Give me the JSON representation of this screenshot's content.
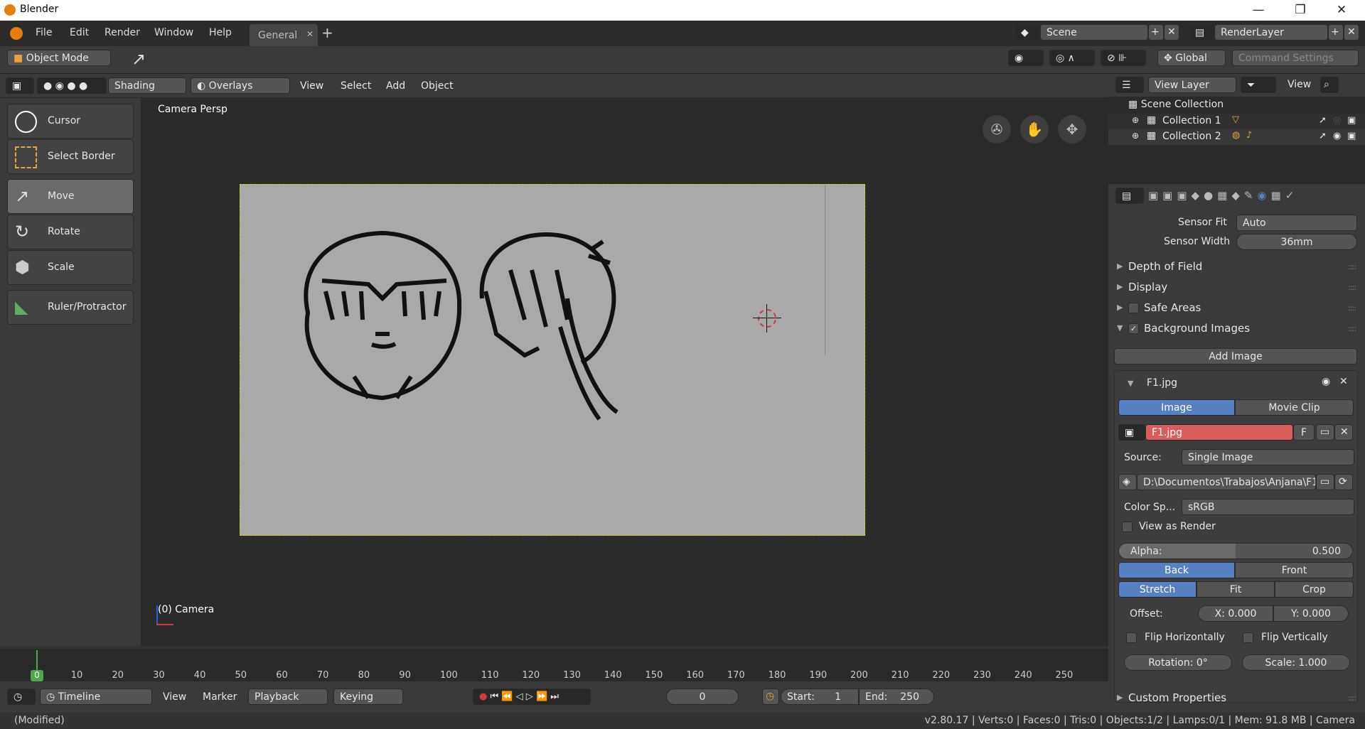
{
  "window": {
    "title": "Blender",
    "min": "—",
    "max": "❐",
    "close": "✕"
  },
  "menu": {
    "file": "File",
    "edit": "Edit",
    "render": "Render",
    "window": "Window",
    "help": "Help"
  },
  "workspace_tab": {
    "label": "General",
    "close": "✕",
    "add": "+"
  },
  "scene": {
    "name": "Scene",
    "render_layer": "RenderLayer"
  },
  "header": {
    "mode": "Object Mode",
    "orientation": "Global",
    "command_settings": "Command Settings",
    "shading": "Shading",
    "overlays": "Overlays",
    "view": "View",
    "select": "Select",
    "add": "Add",
    "object": "Object"
  },
  "tools": [
    {
      "label": "Cursor"
    },
    {
      "label": "Select Border"
    },
    {
      "label": "Move"
    },
    {
      "label": "Rotate"
    },
    {
      "label": "Scale"
    },
    {
      "label": "Ruler/Protractor"
    }
  ],
  "viewport": {
    "camera_label": "Camera Persp",
    "object_label": "(0) Camera"
  },
  "timeline": {
    "ticks": [
      "0",
      "10",
      "20",
      "30",
      "40",
      "50",
      "60",
      "70",
      "80",
      "90",
      "100",
      "110",
      "120",
      "130",
      "140",
      "150",
      "160",
      "170",
      "180",
      "190",
      "200",
      "210",
      "220",
      "230",
      "240",
      "250"
    ],
    "current_frame_marker": "0",
    "editor": "Timeline",
    "view": "View",
    "marker": "Marker",
    "playback": "Playback",
    "keying": "Keying",
    "frame": "0",
    "start_label": "Start:",
    "start": "1",
    "end_label": "End:",
    "end": "250"
  },
  "status": {
    "left": "(Modified)",
    "right": "v2.80.17 | Verts:0 | Faces:0 | Tris:0 | Objects:1/2 | Lamps:0/1 | Mem: 91.8 MB | Camera"
  },
  "outliner": {
    "view_layer": "View Layer",
    "view": "View",
    "scene_collection": "Scene Collection",
    "collections": [
      "Collection 1",
      "Collection 2"
    ]
  },
  "properties": {
    "sensor_fit_label": "Sensor Fit",
    "sensor_fit": "Auto",
    "sensor_width_label": "Sensor Width",
    "sensor_width": "36mm",
    "panels": {
      "dof": "Depth of Field",
      "display": "Display",
      "safe_areas": "Safe Areas",
      "bg_images": "Background Images",
      "custom": "Custom Properties"
    },
    "add_image": "Add Image",
    "image_name": "F1.jpg",
    "image_tab": "Image",
    "movie_tab": "Movie Clip",
    "image_field": "F1.jpg",
    "fake_user": "F",
    "source_label": "Source:",
    "source": "Single Image",
    "path": "D:\\Documentos\\Trabajos\\Anjana\\F1....",
    "colorspace_label": "Color Sp...",
    "colorspace": "sRGB",
    "view_as_render": "View as Render",
    "alpha_label": "Alpha:",
    "alpha": "0.500",
    "alpha_fraction": 0.5,
    "back": "Back",
    "front": "Front",
    "stretch": "Stretch",
    "fit": "Fit",
    "crop": "Crop",
    "offset_label": "Offset:",
    "offset_x": "X:  0.000",
    "offset_y": "Y:  0.000",
    "flip_h": "Flip Horizontally",
    "flip_v": "Flip Vertically",
    "rotation": "Rotation:     0°",
    "scale": "Scale:       1.000"
  },
  "colors": {
    "accent_blue": "#5680c2",
    "image_field_red": "#d95d5d",
    "frame_green": "#4caa4a",
    "camera_border": "#d8d800"
  }
}
